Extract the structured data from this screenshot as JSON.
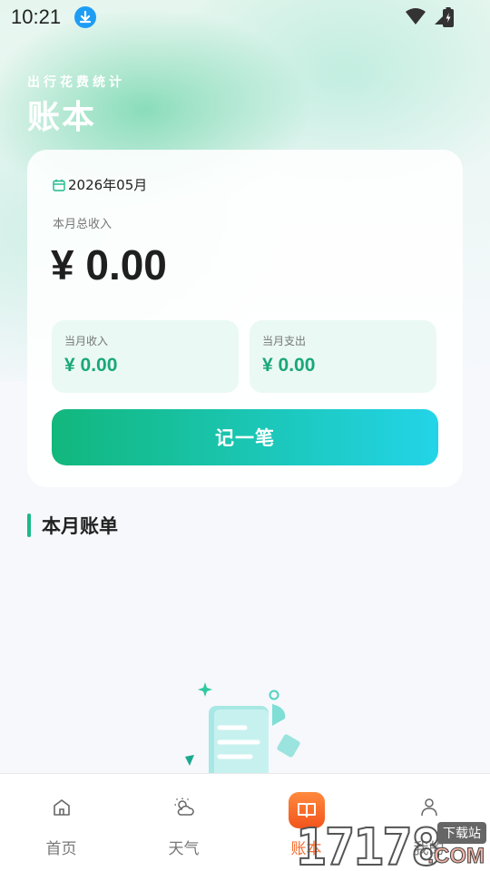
{
  "status_bar": {
    "time": "10:21",
    "icons": [
      "download-icon",
      "wifi-icon",
      "signal-icon",
      "battery-icon"
    ]
  },
  "header": {
    "subtitle": "出行花费统计",
    "title": "账本"
  },
  "summary_card": {
    "date": "2026年05月",
    "total_income_label": "本月总收入",
    "total_income_value": "¥ 0.00",
    "month_income_label": "当月收入",
    "month_income_value": "¥ 0.00",
    "month_expense_label": "当月支出",
    "month_expense_value": "¥ 0.00",
    "record_button": "记一笔"
  },
  "section": {
    "title": "本月账单"
  },
  "tabbar": {
    "items": [
      {
        "label": "首页",
        "icon": "home-icon",
        "active": false
      },
      {
        "label": "天气",
        "icon": "weather-icon",
        "active": false
      },
      {
        "label": "账本",
        "icon": "book-icon",
        "active": true
      },
      {
        "label": "我的",
        "icon": "user-icon",
        "active": false
      }
    ]
  },
  "colors": {
    "accent_green": "#1bb98a",
    "active_tab": "#f36b2e",
    "value_green": "#19a77a"
  },
  "watermark": {
    "digits": "17178",
    "tag": "下载站",
    "domain": ".COM"
  }
}
